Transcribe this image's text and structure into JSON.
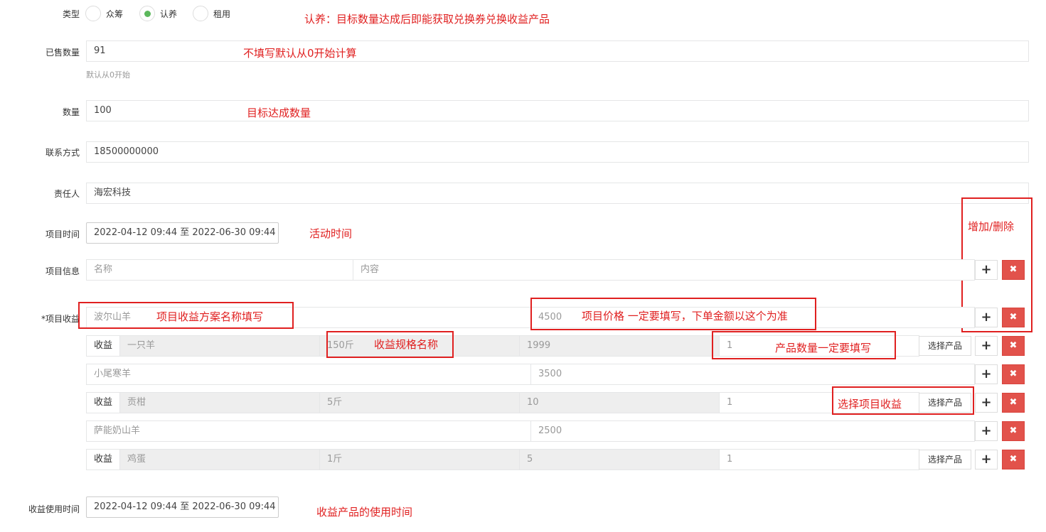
{
  "form": {
    "type": {
      "label": "类型",
      "options": [
        "众筹",
        "认养",
        "租用"
      ],
      "selected": 1
    },
    "sold": {
      "label": "已售数量",
      "value": "91",
      "help": "默认从0开始"
    },
    "quantity": {
      "label": "数量",
      "value": "100"
    },
    "contact": {
      "label": "联系方式",
      "value": "18500000000"
    },
    "owner": {
      "label": "责任人",
      "value": "海宏科技"
    },
    "project_time": {
      "label": "项目时间",
      "value": "2022-04-12 09:44 至 2022-06-30 09:44"
    },
    "project_info": {
      "label": "项目信息",
      "name_placeholder": "名称",
      "content_placeholder": "内容"
    },
    "project_income": {
      "label": "*项目收益",
      "addon_label": "收益",
      "pick_label": "选择产品",
      "plus": "+",
      "del": "✖",
      "plans": [
        {
          "name": "波尔山羊",
          "price": "4500",
          "product": {
            "name": "一只羊",
            "spec": "150斤",
            "price": "1999",
            "qty": "1"
          }
        },
        {
          "name": "小尾寒羊",
          "price": "3500",
          "product": {
            "name": "贡柑",
            "spec": "5斤",
            "price": "10",
            "qty": "1"
          }
        },
        {
          "name": "萨能奶山羊",
          "price": "2500",
          "product": {
            "name": "鸡蛋",
            "spec": "1斤",
            "price": "5",
            "qty": "1"
          }
        }
      ]
    },
    "income_time": {
      "label": "收益使用时间",
      "value": "2022-04-12 09:44 至 2022-06-30 09:44"
    },
    "calendar_icon": "calendar-icon"
  },
  "annotations": {
    "type_note": "认养：目标数量达成后即能获取兑换券兑换收益产品",
    "sold_note": "不填写默认从0开始计算",
    "qty_note": "目标达成数量",
    "time_note": "活动时间",
    "add_del_note": "增加/删除",
    "plan_name_note": "项目收益方案名称填写",
    "price_note": "项目价格 一定要填写，下单金额以这个为准",
    "spec_note": "收益规格名称",
    "qty_product_note": "产品数量一定要填写",
    "pick_note": "选择项目收益",
    "income_time_note": "收益产品的使用时间"
  },
  "colors": {
    "annotation": "#e02020",
    "danger": "#e2524b",
    "radio_on": "#5cb85c"
  }
}
